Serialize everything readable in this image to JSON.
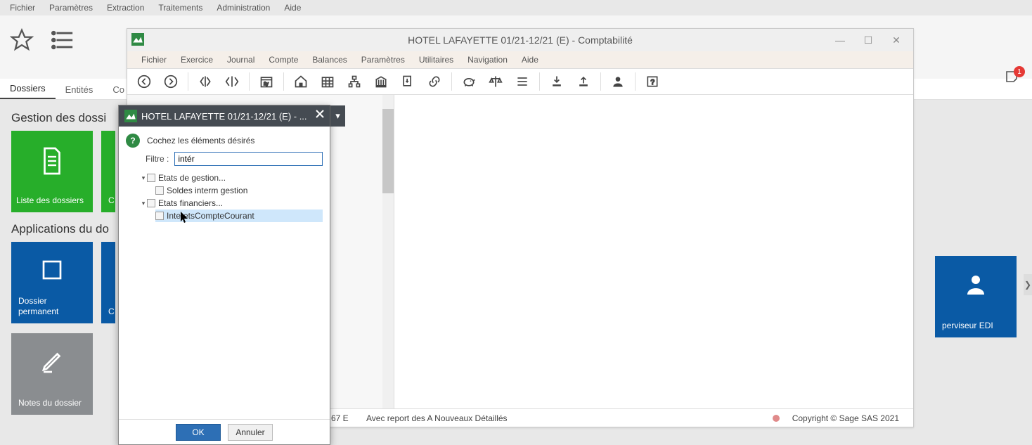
{
  "main_menu": [
    "Fichier",
    "Paramètres",
    "Extraction",
    "Traitements",
    "Administration",
    "Aide"
  ],
  "notif_count": "1",
  "tabs": {
    "dossiers": "Dossiers",
    "entites": "Entités",
    "co": "Co"
  },
  "sections": {
    "gestion": "Gestion des dossi",
    "applications": "Applications du do"
  },
  "tiles": {
    "liste": "Liste des dossiers",
    "c_green": "C",
    "dossier_perm": "Dossier permanent",
    "c_blue": "C",
    "notes": "Notes du dossier",
    "superviseur": "perviseur EDI"
  },
  "child": {
    "title": "HOTEL LAFAYETTE 01/21-12/21 (E) - Comptabilité",
    "menu": [
      "Fichier",
      "Exercice",
      "Journal",
      "Compte",
      "Balances",
      "Paramètres",
      "Utilitaires",
      "Navigation",
      "Aide"
    ],
    "status": {
      "code": "67 E",
      "report": "Avec report des A Nouveaux Détaillés",
      "copyright": "Copyright © Sage SAS 2021"
    }
  },
  "modal": {
    "title": "HOTEL LAFAYETTE 01/21-12/21 (E) - ...",
    "instruction": "Cochez les éléments désirés",
    "filter_label": "Filtre :",
    "filter_value": "intér",
    "tree": {
      "n1": "Etats de gestion...",
      "n1a": "Soldes interm gestion",
      "n2": "Etats financiers...",
      "n2a": "InteretsCompteCourant"
    },
    "ok": "OK",
    "cancel": "Annuler"
  }
}
